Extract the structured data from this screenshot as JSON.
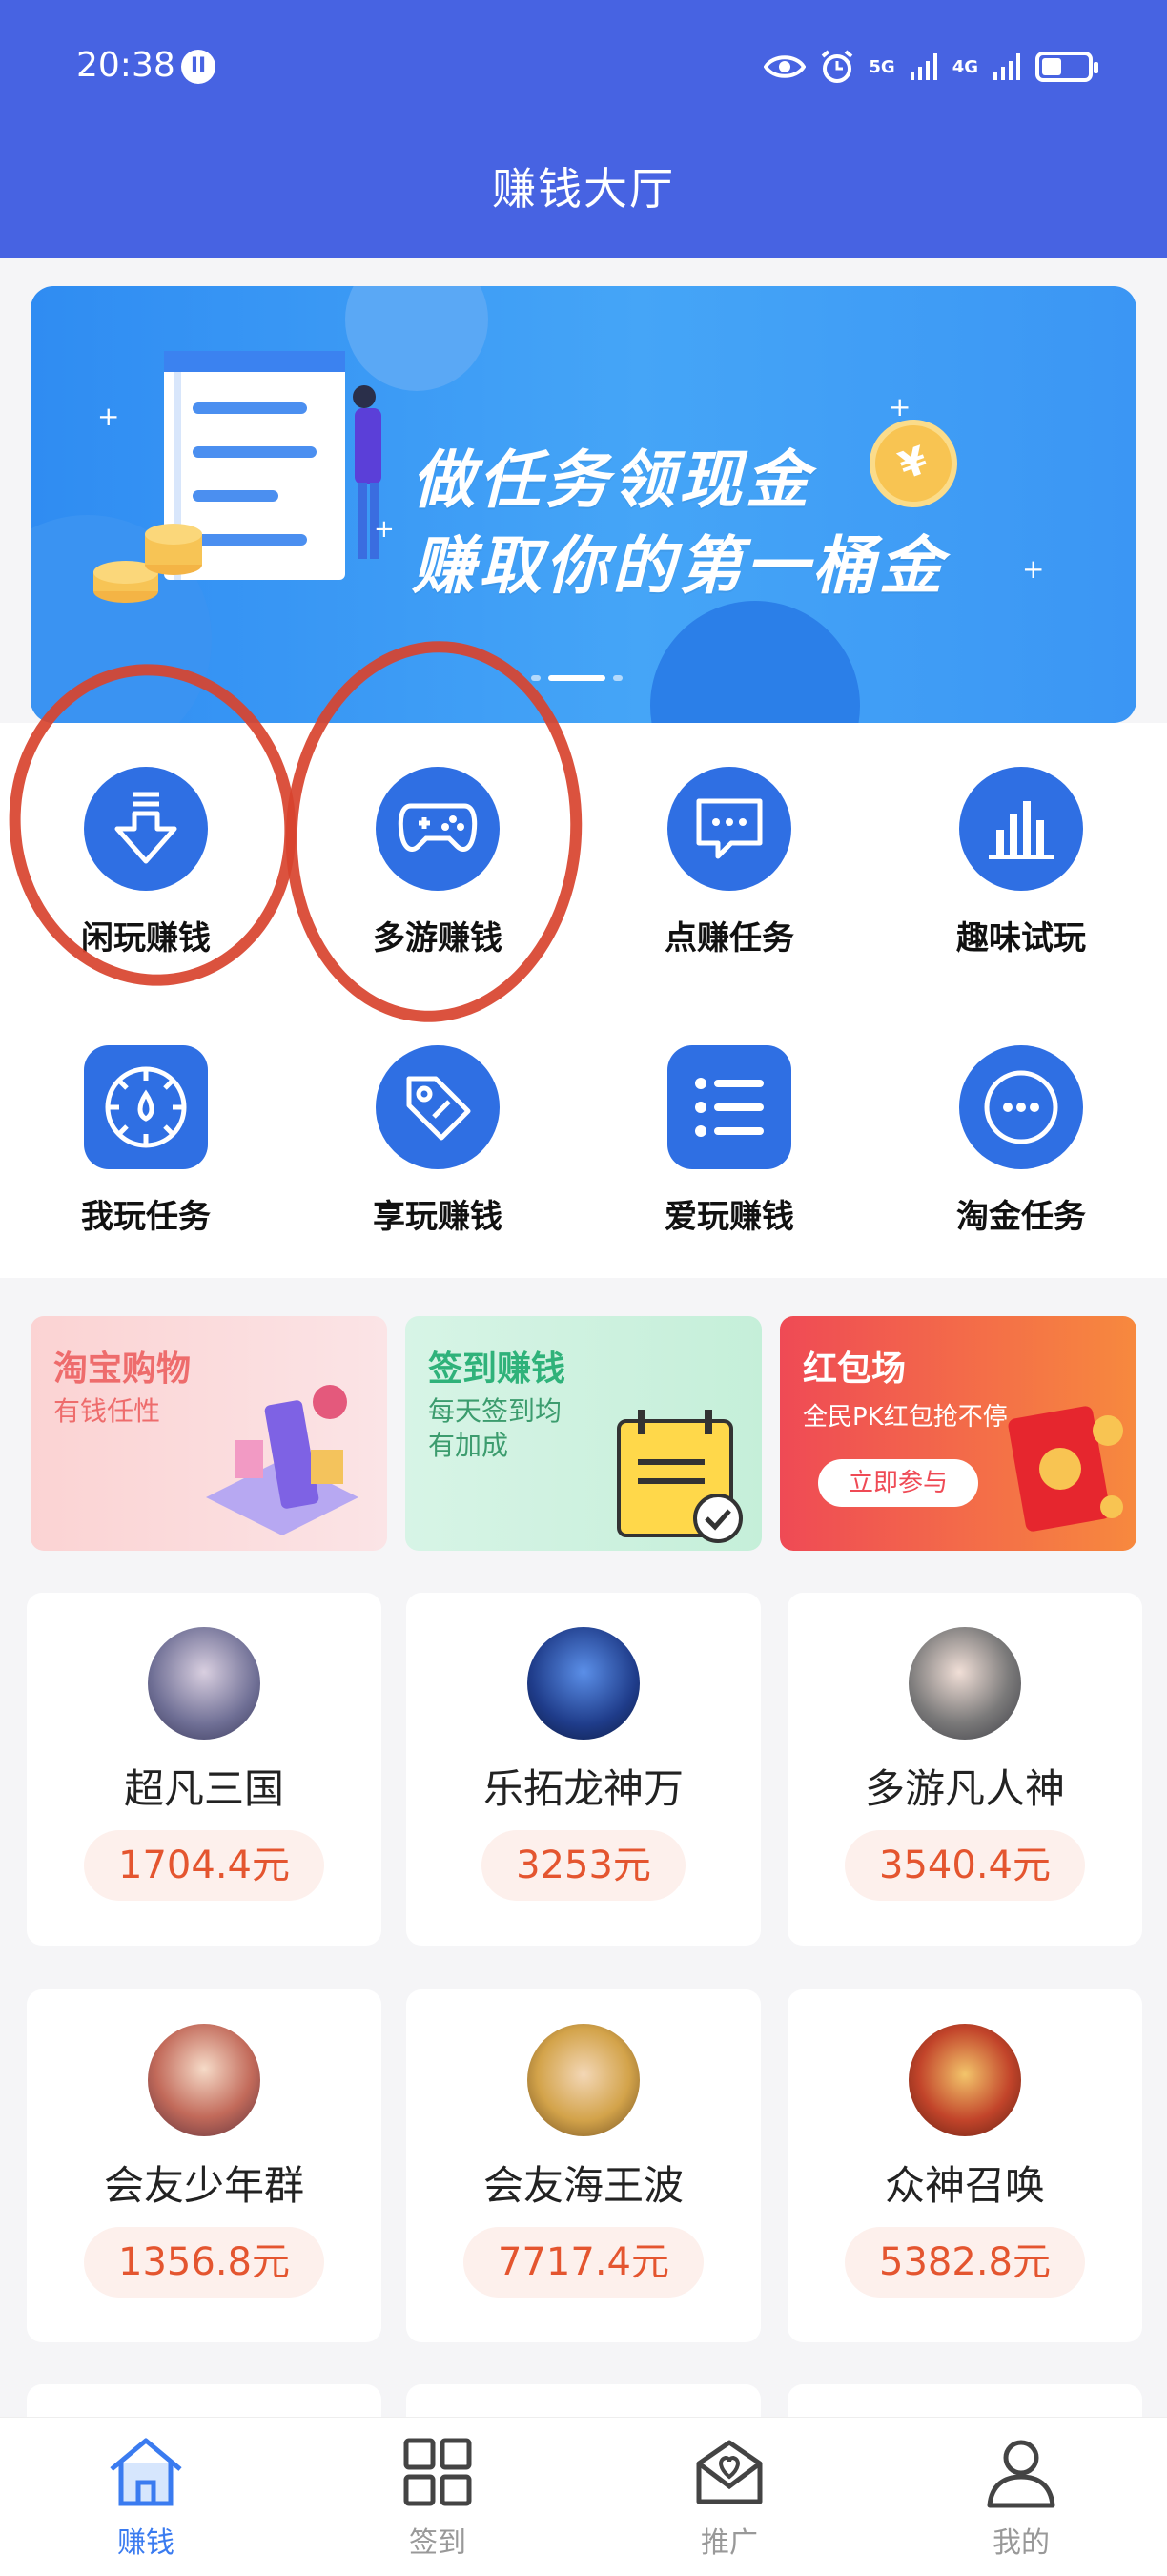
{
  "status_bar": {
    "time": "20:38",
    "badge": "II",
    "net1": "5G",
    "net2": "4G"
  },
  "header": {
    "title": "赚钱大厅",
    "bg_color": "#4763e2"
  },
  "banner": {
    "line1": "做任务领现金",
    "line2": "赚取你的第一桶金",
    "coin_symbol": "¥"
  },
  "features": [
    {
      "label": "闲玩赚钱",
      "icon": "download-arrow-icon"
    },
    {
      "label": "多游赚钱",
      "icon": "gamepad-icon"
    },
    {
      "label": "点赚任务",
      "icon": "chat-bubble-icon"
    },
    {
      "label": "趣味试玩",
      "icon": "bar-chart-icon"
    },
    {
      "label": "我玩任务",
      "icon": "compass-icon"
    },
    {
      "label": "享玩赚钱",
      "icon": "tag-icon"
    },
    {
      "label": "爱玩赚钱",
      "icon": "list-icon"
    },
    {
      "label": "淘金任务",
      "icon": "more-dots-icon"
    }
  ],
  "promos": [
    {
      "title": "淘宝购物",
      "subtitle": "有钱任性"
    },
    {
      "title": "签到赚钱",
      "subtitle_line1": "每天签到均",
      "subtitle_line2": "有加成"
    },
    {
      "title": "红包场",
      "subtitle": "全民PK红包抢不停",
      "button": "立即参与"
    }
  ],
  "games": [
    {
      "name": "超凡三国",
      "reward": "1704.4元"
    },
    {
      "name": "乐拓龙神万",
      "reward": "3253元"
    },
    {
      "name": "多游凡人神",
      "reward": "3540.4元"
    },
    {
      "name": "会友少年群",
      "reward": "1356.8元"
    },
    {
      "name": "会友海王波",
      "reward": "7717.4元"
    },
    {
      "name": "众神召唤",
      "reward": "5382.8元"
    }
  ],
  "bottom_nav": [
    {
      "label": "赚钱",
      "icon": "home-icon",
      "active": true
    },
    {
      "label": "签到",
      "icon": "grid-icon",
      "active": false
    },
    {
      "label": "推广",
      "icon": "heart-envelope-icon",
      "active": false
    },
    {
      "label": "我的",
      "icon": "user-icon",
      "active": false
    }
  ],
  "colors": {
    "primary": "#4763e2",
    "icon_blue": "#2f6fe3",
    "price_text": "#e4552f",
    "annotation_red": "#d8432e",
    "nav_active": "#3a7bf0"
  }
}
